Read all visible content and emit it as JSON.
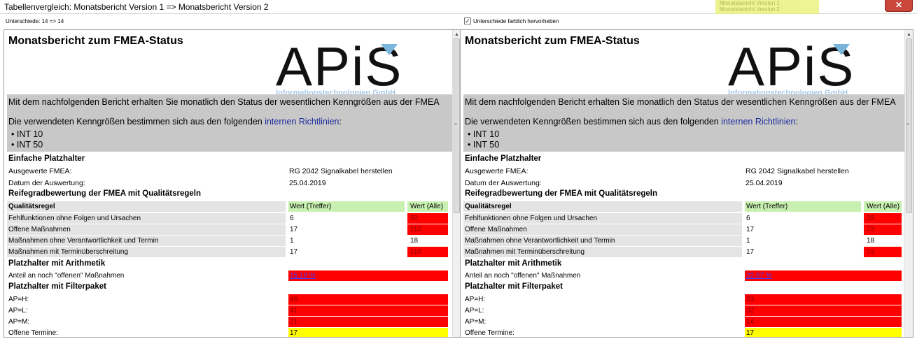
{
  "window": {
    "title": "Tabellenvergleich: Monatsbericht Version 1 => Monatsbericht Version 2",
    "bg_hint_1": "Monatsbericht Version 1",
    "bg_hint_2": "Monatsbericht Version 2",
    "close_glyph": "✕"
  },
  "toolbar": {
    "diff_count": "Unterschiede: 14 => 14",
    "highlight_label": "Unterschiede farblich hervorheben",
    "highlight_checked": "✓"
  },
  "colors": {
    "diff_red": "#ff0000",
    "diff_yellow": "#ffff00",
    "header_green": "#c8f0b0",
    "gray_box": "#c8c8c8"
  },
  "left": {
    "report_title": "Monatsbericht zum FMEA-Status",
    "logo": {
      "letters": "APiS",
      "subtitle": "Informationstechnologien GmbH"
    },
    "intro": "Mit dem nachfolgenden Bericht erhalten Sie monatlich den Status der wesentlichen Kenngrößen aus der FMEA",
    "kpi_prefix": "Die verwendeten Kenngrößen bestimmen sich aus den folgenden ",
    "kpi_link": "internen Richtlinien",
    "kpi_suffix": ":",
    "bullets": [
      "INT 10",
      "INT 50"
    ],
    "sec_simple": "Einfache Platzhalter",
    "fmea_label": "Ausgewerte FMEA:",
    "fmea_value": "RG 2042 Signalkabel herstellen",
    "date_label": "Datum der Auswertung:",
    "date_value": "25.04.2019",
    "sec_maturity": "Reifegradbewertung der FMEA mit Qualitätsregeln",
    "table_head": {
      "rule": "Qualitätsregel",
      "hits": "Wert (Treffer)",
      "all": "Wert (Alle)"
    },
    "rows": [
      {
        "rule": "Fehlfunktionen ohne Folgen und Ursachen",
        "hits": "6",
        "all": "50"
      },
      {
        "rule": "Offene Maßnahmen",
        "hits": "17",
        "all": "110"
      },
      {
        "rule": "Maßnahmen ohne Verantwortlichkeit und Termin",
        "hits": "1",
        "all": "18"
      },
      {
        "rule": "Maßnahmen mit Terminüberschreitung",
        "hits": "17",
        "all": "110"
      }
    ],
    "sec_arith": "Platzhalter mit Arithmetik",
    "open_share_label": "Anteil an noch \"offenen\" Maßnahmen",
    "open_share_value": "15,18 %",
    "sec_filter": "Platzhalter mit Filterpaket",
    "ap_h_label": "AP=H:",
    "ap_h_value": "46",
    "ap_l_label": "AP=L:",
    "ap_l_value": "41",
    "ap_m_label": "AP=M:",
    "ap_m_value": "21",
    "open_dates_label": "Offene Termine:",
    "open_dates_value": "17"
  },
  "right": {
    "report_title": "Monatsbericht zum FMEA-Status",
    "logo": {
      "letters": "APiS",
      "subtitle": "Informationstechnologien GmbH"
    },
    "intro": "Mit dem nachfolgenden Bericht erhalten Sie monatlich den Status der wesentlichen Kenngrößen aus der FMEA",
    "kpi_prefix": "Die verwendeten Kenngrößen bestimmen sich aus den folgenden ",
    "kpi_link": "internen Richtlinien",
    "kpi_suffix": ":",
    "bullets": [
      "INT 10",
      "INT 50"
    ],
    "sec_simple": "Einfache Platzhalter",
    "fmea_label": "Ausgewerte FMEA:",
    "fmea_value": "RG 2042 Signalkabel herstellen",
    "date_label": "Datum der Auswertung:",
    "date_value": "25.04.2019",
    "sec_maturity": "Reifegradbewertung der FMEA mit Qualitätsregeln",
    "table_head": {
      "rule": "Qualitätsregel",
      "hits": "Wert (Treffer)",
      "all": "Wert (Alle)"
    },
    "rows": [
      {
        "rule": "Fehlfunktionen ohne Folgen und Ursachen",
        "hits": "6",
        "all": "39"
      },
      {
        "rule": "Offene Maßnahmen",
        "hits": "17",
        "all": "73"
      },
      {
        "rule": "Maßnahmen ohne Verantwortlichkeit und Termin",
        "hits": "1",
        "all": "18"
      },
      {
        "rule": "Maßnahmen mit Terminüberschreitung",
        "hits": "17",
        "all": "73"
      }
    ],
    "sec_arith": "Platzhalter mit Arithmetik",
    "open_share_label": "Anteil an noch \"offenen\" Maßnahmen",
    "open_share_value": "22,67 %",
    "sec_filter": "Platzhalter mit Filterpaket",
    "ap_h_label": "AP=H:",
    "ap_h_value": "33",
    "ap_l_label": "AP=L:",
    "ap_l_value": "32",
    "ap_m_label": "AP=M:",
    "ap_m_value": "14",
    "open_dates_label": "Offene Termine:",
    "open_dates_value": "17"
  }
}
